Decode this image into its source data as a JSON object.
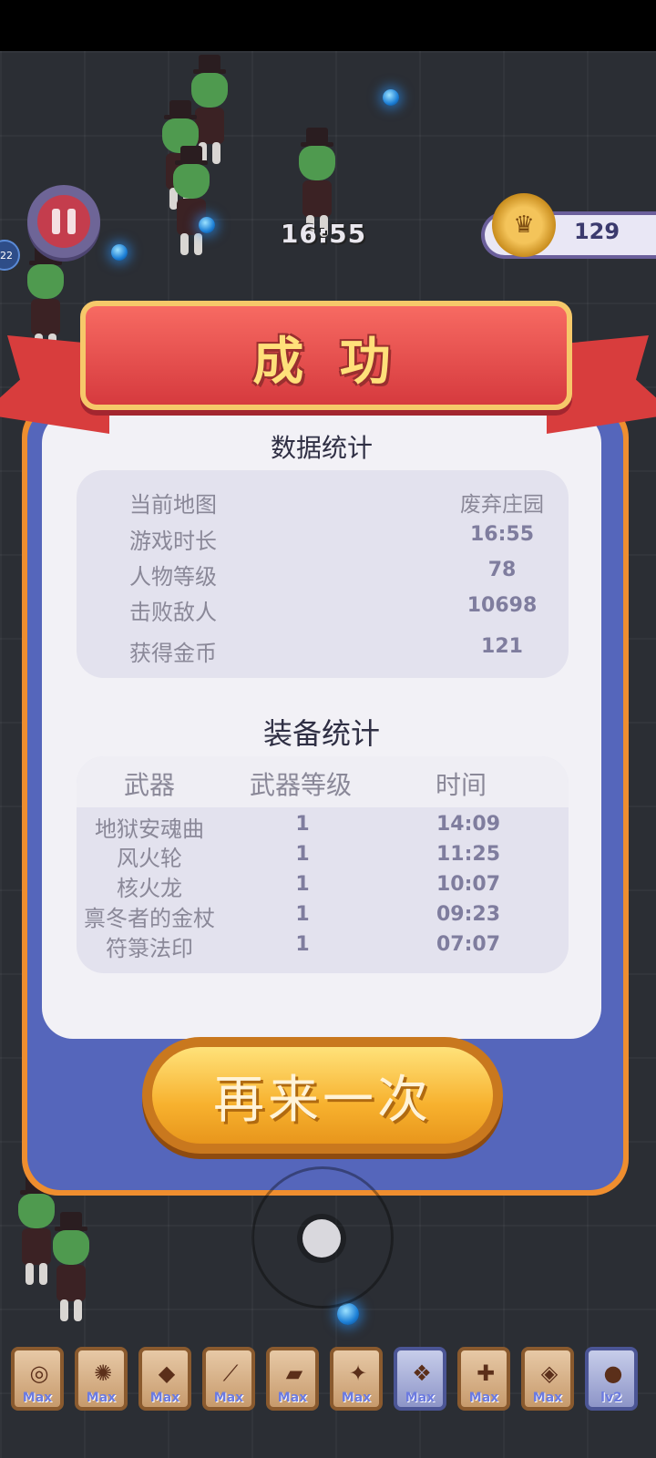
{
  "hud": {
    "timer": "16:55",
    "gold": "129",
    "level_badge": "22"
  },
  "dialog": {
    "title": "成 功",
    "stats_title": "数据统计",
    "stats": [
      {
        "label": "当前地图",
        "value": "废弃庄园"
      },
      {
        "label": "游戏时长",
        "value": "16:55"
      },
      {
        "label": "人物等级",
        "value": "78"
      },
      {
        "label": "击败敌人",
        "value": "10698"
      },
      {
        "label": "获得金币",
        "value": "121"
      }
    ],
    "equip_title": "装备统计",
    "equip_columns": [
      "武器",
      "武器等级",
      "时间"
    ],
    "equipment": [
      {
        "name": "地狱安魂曲",
        "level": "1",
        "time": "14:09"
      },
      {
        "name": "风火轮",
        "level": "1",
        "time": "11:25"
      },
      {
        "name": "核火龙",
        "level": "1",
        "time": "10:07"
      },
      {
        "name": "禀冬者的金杖",
        "level": "1",
        "time": "09:23"
      },
      {
        "name": "符箓法印",
        "level": "1",
        "time": "07:07"
      }
    ],
    "retry_label": "再来一次"
  },
  "skill_bar": [
    {
      "icon": "fire-ring-icon",
      "label": "Max"
    },
    {
      "icon": "wheel-icon",
      "label": "Max"
    },
    {
      "icon": "dragon-icon",
      "label": "Max"
    },
    {
      "icon": "staff-icon",
      "label": "Max"
    },
    {
      "icon": "talisman-icon",
      "label": "Max"
    },
    {
      "icon": "wand-icon",
      "label": "Max"
    },
    {
      "icon": "wings-icon",
      "label": "Max"
    },
    {
      "icon": "torch-icon",
      "label": "Max"
    },
    {
      "icon": "gauntlet-icon",
      "label": "Max"
    },
    {
      "icon": "orb-icon",
      "label": "lv2"
    }
  ],
  "colors": {
    "ribbon": "#d63a3e",
    "panel_border": "#ef8e2f",
    "panel_body": "#5566bb",
    "button": "#f7b12e"
  }
}
